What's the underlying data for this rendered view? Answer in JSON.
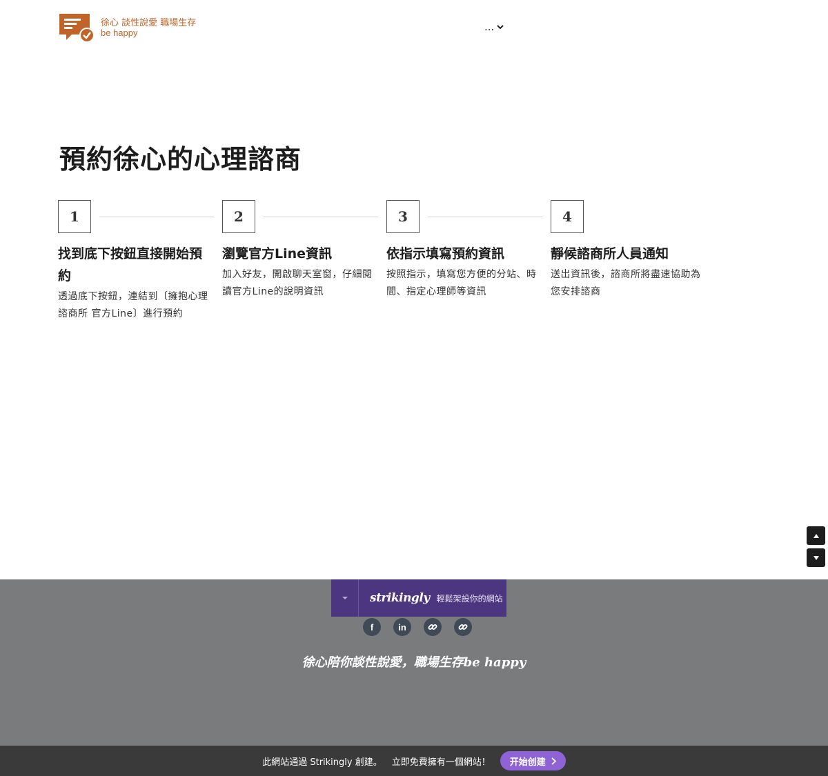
{
  "header": {
    "logo_line1": "徐心 談性說愛 職場生存",
    "logo_line2": "be happy",
    "nav_more": "...",
    "brand_color": "#c0642a"
  },
  "main": {
    "title": "預約徐心的心理諮商",
    "steps": [
      {
        "number": "1",
        "title": "找到底下按鈕直接開始預約",
        "desc": "透過底下按鈕，連結到〔擁抱心理諮商所 官方Line〕進行預約"
      },
      {
        "number": "2",
        "title": "瀏覽官方Line資訊",
        "desc": "加入好友，開啟聊天室窗，仔細閱讀官方Line的說明資訊"
      },
      {
        "number": "3",
        "title": "依指示填寫預約資訊",
        "desc": "按照指示，填寫您方便的分站、時間、指定心理師等資訊"
      },
      {
        "number": "4",
        "title": "靜候諮商所人員通知",
        "desc": "送出資訊後，諮商所將盡速協助為您安排諮商"
      }
    ]
  },
  "side_nav": {
    "up_icon": "triangle-up-icon",
    "down_icon": "triangle-down-icon"
  },
  "footer": {
    "badge_brand": "strikingly",
    "badge_tagline": "輕鬆架設你的網站",
    "socials": [
      {
        "icon": "facebook-icon",
        "glyph": "f"
      },
      {
        "icon": "linkedin-icon",
        "glyph": "in"
      },
      {
        "icon": "link-icon",
        "glyph": ""
      },
      {
        "icon": "link-icon",
        "glyph": ""
      }
    ],
    "slogan": "徐心陪你談性說愛，職場生存be happy",
    "background": "#7a7b7d",
    "badge_color": "#4c367f"
  },
  "bottom_bar": {
    "text": "此網站通過 Strikingly 創建。",
    "cta": "立即免費擁有一個網站！",
    "button_label": "开始创建",
    "button_color": "#8f63d6"
  }
}
